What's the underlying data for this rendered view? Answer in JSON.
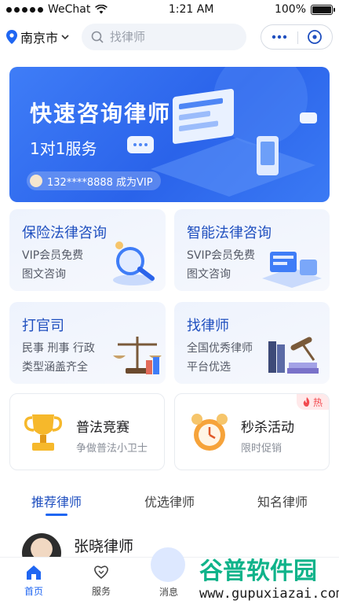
{
  "status": {
    "carrier": "WeChat",
    "time": "1:21 AM",
    "battery": "100%"
  },
  "nav": {
    "city": "南京市",
    "search_placeholder": "找律师"
  },
  "banner": {
    "title": "快速咨询律师",
    "subtitle": "1对1服务",
    "vip_text": "132****8888 成为VIP"
  },
  "cards": [
    {
      "title": "保险法律咨询",
      "sub1": "VIP会员免费",
      "sub2": "图文咨询"
    },
    {
      "title": "智能法律咨询",
      "sub1": "SVIP会员免费",
      "sub2": "图文咨询"
    },
    {
      "title": "打官司",
      "sub1": "民事 刑事 行政",
      "sub2": "类型涵盖齐全"
    },
    {
      "title": "找律师",
      "sub1": "全国优秀律师",
      "sub2": "平台优选"
    }
  ],
  "small_cards": [
    {
      "title": "普法竞赛",
      "sub": "争做普法小卫士"
    },
    {
      "title": "秒杀活动",
      "sub": "限时促销",
      "badge": "热"
    }
  ],
  "tabs": [
    "推荐律师",
    "优选律师",
    "知名律师"
  ],
  "lawyer": {
    "name": "张晓律师"
  },
  "bottom_nav": [
    "首页",
    "服务",
    "消息"
  ],
  "watermark": {
    "title": "谷普软件园",
    "url": "www.gupuxiazai.com"
  },
  "colors": {
    "accent": "#1f66f2",
    "card_title": "#1f4fbf",
    "hot": "#f24a4f"
  }
}
